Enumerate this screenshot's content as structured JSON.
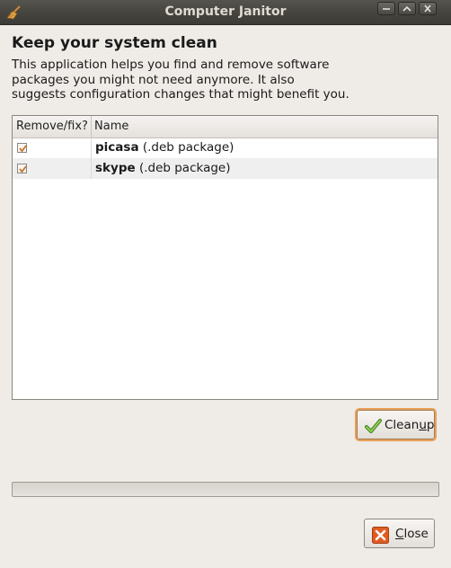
{
  "window": {
    "title": "Computer Janitor"
  },
  "header": {
    "heading": "Keep your system clean",
    "description_lines": [
      "This application helps you find and remove software",
      "packages you might not need anymore. It also",
      "suggests configuration changes that might benefit you."
    ]
  },
  "list": {
    "columns": [
      "Remove/fix?",
      "Name"
    ],
    "rows": [
      {
        "checked": true,
        "name": "picasa",
        "type": "(.deb package)"
      },
      {
        "checked": true,
        "name": "skype",
        "type": "(.deb package)"
      }
    ]
  },
  "buttons": {
    "cleanup": {
      "label_pre": "Clean",
      "label_mnemonic": "u",
      "label_post": "p",
      "icon": "check-icon"
    },
    "close": {
      "label_pre": "",
      "label_mnemonic": "C",
      "label_post": "lose",
      "icon": "close-x-icon"
    }
  },
  "progress": {
    "fraction": 0
  },
  "colors": {
    "accent": "#e9a05a",
    "titlebar": "#47453f",
    "background": "#efebe7"
  }
}
